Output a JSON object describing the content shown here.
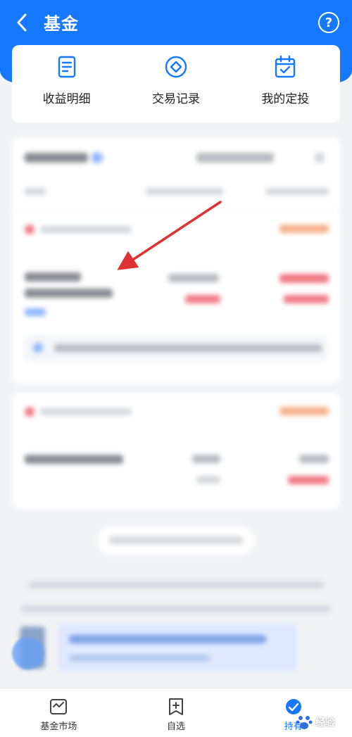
{
  "header": {
    "title": "基金",
    "back_icon": "chevron-left-icon",
    "help_icon": "question-circle-icon",
    "help_symbol": "?"
  },
  "shortcuts": [
    {
      "label": "收益明细",
      "icon": "document-list-icon"
    },
    {
      "label": "交易记录",
      "icon": "diamond-circle-icon"
    },
    {
      "label": "我的定投",
      "icon": "calendar-check-icon"
    }
  ],
  "bottom_nav": [
    {
      "label": "基金市场",
      "icon": "market-chart-icon",
      "active": false
    },
    {
      "label": "自选",
      "icon": "bookmark-plus-icon",
      "active": false
    },
    {
      "label": "持有",
      "icon": "holdings-icon",
      "active": true
    }
  ],
  "watermark": {
    "text": "经验"
  },
  "colors": {
    "primary": "#1677ff",
    "background": "#f2f3f5",
    "arrow": "#e03232"
  }
}
